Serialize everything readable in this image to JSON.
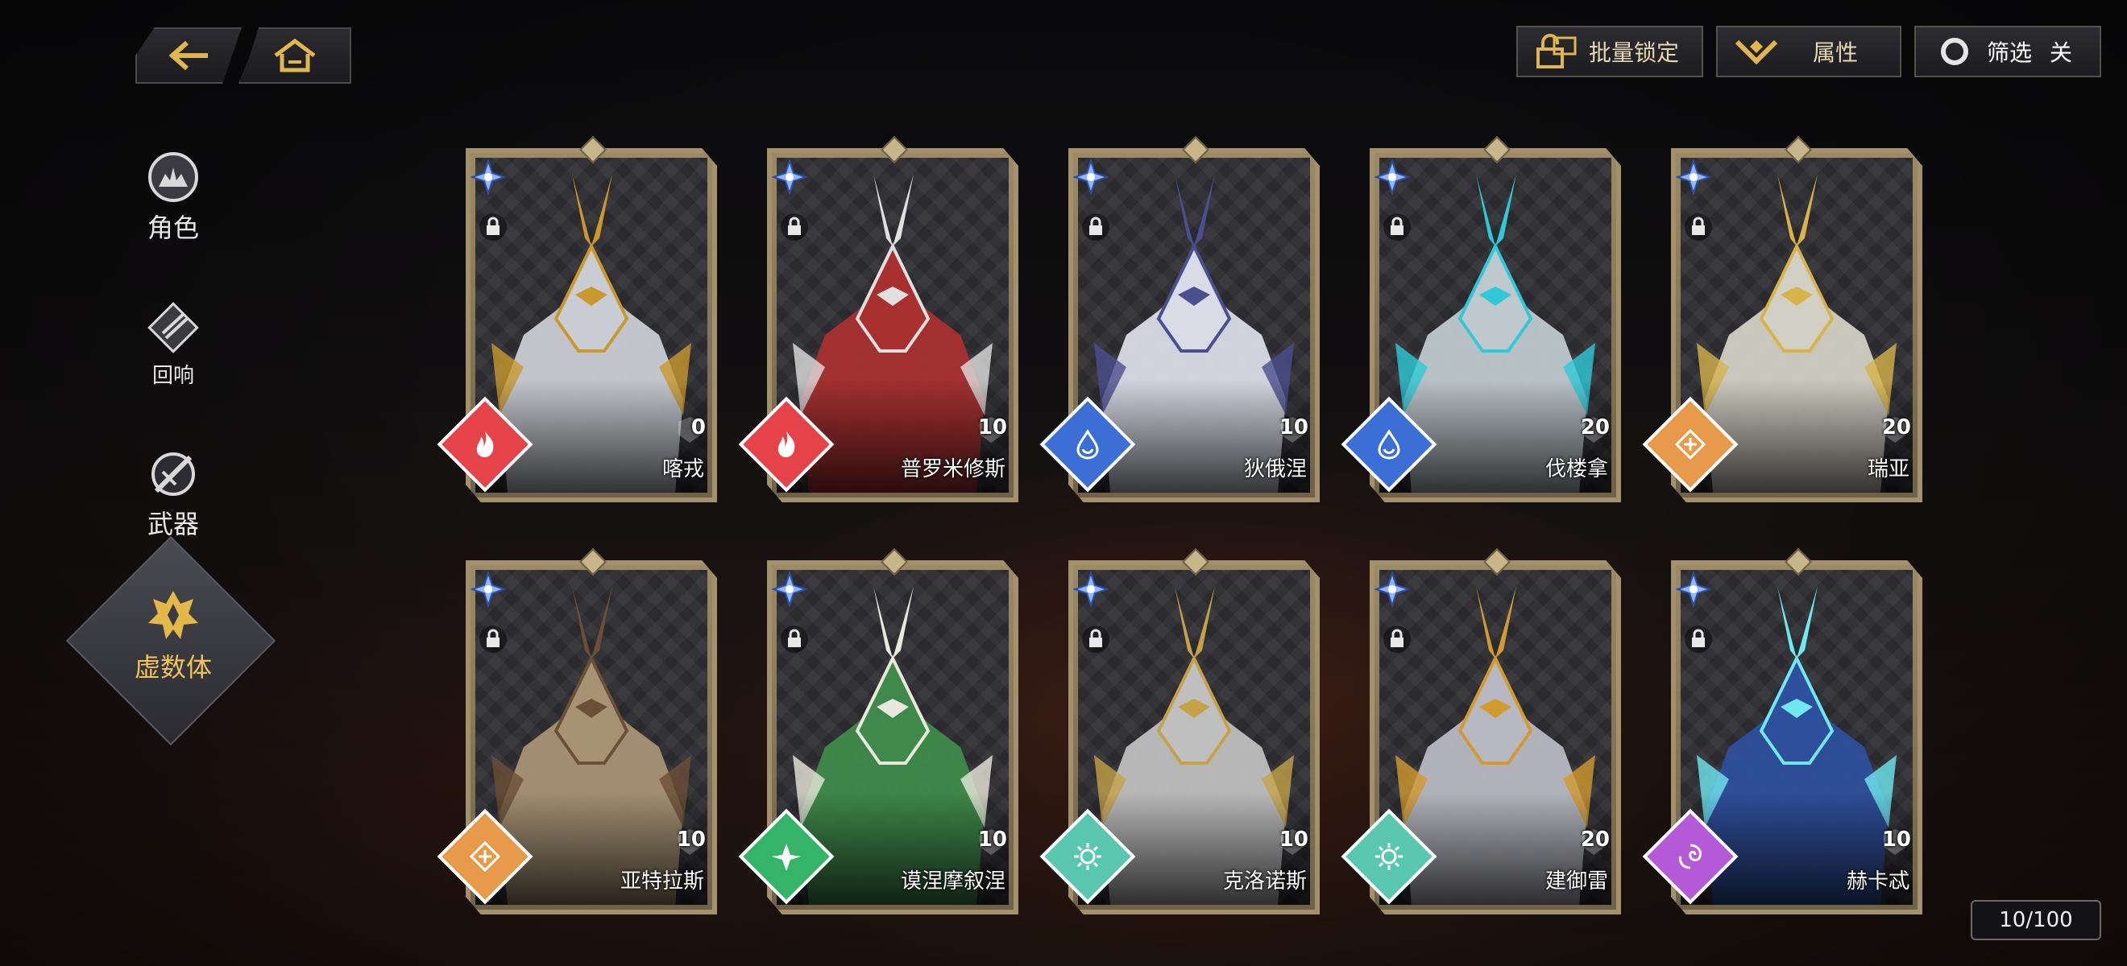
{
  "nav": {
    "back_icon": "back-arrow-icon",
    "home_icon": "home-icon"
  },
  "top_buttons": {
    "batch_lock": "批量锁定",
    "attributes": "属性",
    "filter": "筛选",
    "filter_state": "关"
  },
  "sidebar": {
    "items": [
      {
        "label": "角色",
        "icon": "character-icon"
      },
      {
        "label": "回响",
        "icon": "echo-icon"
      },
      {
        "label": "武器",
        "icon": "weapon-icon"
      },
      {
        "label": "虚数体",
        "icon": "imaginary-icon",
        "active": true
      }
    ]
  },
  "cards": [
    {
      "name": "喀戎",
      "level": "0",
      "element": "fire",
      "element_color": "#e5424a",
      "art_color": "#c9ccd3",
      "accent": "#c9982e"
    },
    {
      "name": "普罗米修斯",
      "level": "10",
      "element": "fire",
      "element_color": "#e5424a",
      "art_color": "#a8302f",
      "accent": "#e0e0e0"
    },
    {
      "name": "狄俄涅",
      "level": "10",
      "element": "water",
      "element_color": "#3b6fd6",
      "art_color": "#d9dbe6",
      "accent": "#4b4f8f"
    },
    {
      "name": "伐楼拿",
      "level": "20",
      "element": "water",
      "element_color": "#3b6fd6",
      "art_color": "#bfc8cc",
      "accent": "#2fc9d8"
    },
    {
      "name": "瑞亚",
      "level": "20",
      "element": "earth",
      "element_color": "#e69a4a",
      "art_color": "#d2d0c4",
      "accent": "#d7b34a"
    },
    {
      "name": "亚特拉斯",
      "level": "10",
      "element": "earth",
      "element_color": "#e69a4a",
      "art_color": "#a89274",
      "accent": "#6b4f36"
    },
    {
      "name": "谟涅摩叙涅",
      "level": "10",
      "element": "wind",
      "element_color": "#35b56a",
      "art_color": "#3f8a4a",
      "accent": "#e8e8dc"
    },
    {
      "name": "克洛诺斯",
      "level": "10",
      "element": "light",
      "element_color": "#59c7b0",
      "art_color": "#bfbfbf",
      "accent": "#c5a24a"
    },
    {
      "name": "建御雷",
      "level": "20",
      "element": "light",
      "element_color": "#59c7b0",
      "art_color": "#b7b8c1",
      "accent": "#d29a2f"
    },
    {
      "name": "赫卡忒",
      "level": "10",
      "element": "void",
      "element_color": "#b45ad8",
      "art_color": "#2e4f9c",
      "accent": "#6fe8f0"
    }
  ],
  "counter": "10/100"
}
